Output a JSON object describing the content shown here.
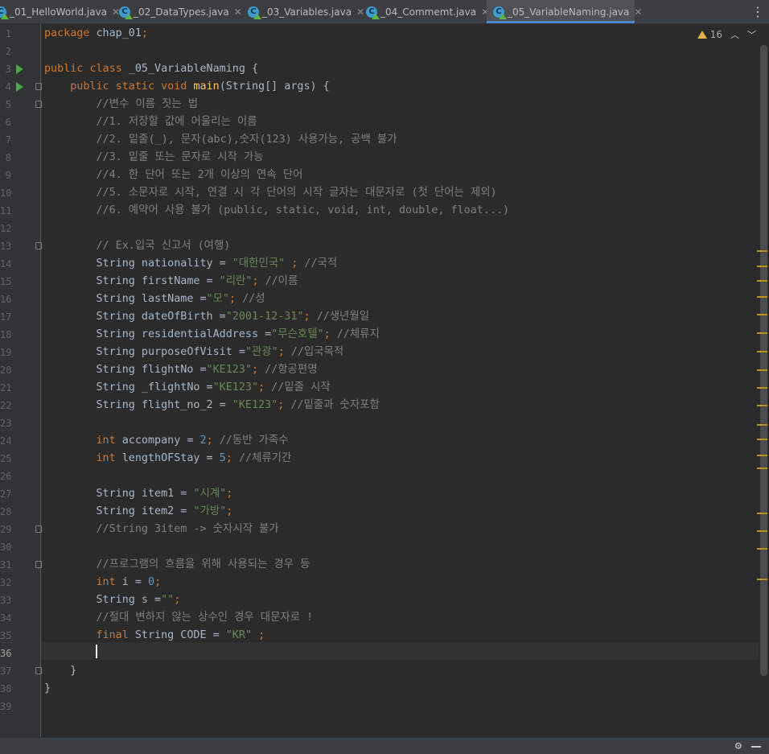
{
  "tabs": [
    {
      "label": "_01_HelloWorld.java",
      "icon": "java-class-icon"
    },
    {
      "label": "_02_DataTypes.java",
      "icon": "java-class-icon"
    },
    {
      "label": "_03_Variables.java",
      "icon": "java-class-icon"
    },
    {
      "label": "_04_Commemt.java",
      "icon": "java-class-icon"
    },
    {
      "label": "_05_VariableNaming.java",
      "icon": "java-class-icon",
      "active": true
    }
  ],
  "inspection": {
    "warning_count": "16"
  },
  "editor": {
    "current_line": 36,
    "lines": [
      {
        "n": "1",
        "t": "package chap_01;"
      },
      {
        "n": "2",
        "t": ""
      },
      {
        "n": "3",
        "t": "public class _05_VariableNaming {"
      },
      {
        "n": "4",
        "t": "    public static void main(String[] args) {"
      },
      {
        "n": "5",
        "t": "        //변수 이름 짓는 법"
      },
      {
        "n": "6",
        "t": "        //1. 저장할 값에 어울리는 이름"
      },
      {
        "n": "7",
        "t": "        //2. 밑줄(_), 문자(abc),숫자(123) 사용가능, 공백 불가"
      },
      {
        "n": "8",
        "t": "        //3. 밑줄 또는 문자로 시작 가능"
      },
      {
        "n": "9",
        "t": "        //4. 한 단어 또는 2개 이상의 연속 단어"
      },
      {
        "n": "10",
        "t": "        //5. 소문자로 시작, 연결 시 각 단어의 시작 글자는 대문자로 (첫 단어는 제외)"
      },
      {
        "n": "11",
        "t": "        //6. 예약어 사용 불가 (public, static, void, int, double, float...)"
      },
      {
        "n": "12",
        "t": ""
      },
      {
        "n": "13",
        "t": "        // Ex.입국 신고서 (여행)"
      },
      {
        "n": "14",
        "t": "        String nationality = \"대한민국\" ; //국적"
      },
      {
        "n": "15",
        "t": "        String firstName = \"리란\"; //이름"
      },
      {
        "n": "16",
        "t": "        String lastName =\"모\"; //성"
      },
      {
        "n": "17",
        "t": "        String dateOfBirth =\"2001-12-31\"; //생년월일"
      },
      {
        "n": "18",
        "t": "        String residentialAddress =\"무슨호텔\"; //체류지"
      },
      {
        "n": "19",
        "t": "        String purposeOfVisit =\"관광\"; //입국목적"
      },
      {
        "n": "20",
        "t": "        String flightNo =\"KE123\"; //항공편명"
      },
      {
        "n": "21",
        "t": "        String _flightNo =\"KE123\"; //밑줄 시작"
      },
      {
        "n": "22",
        "t": "        String flight_no_2 = \"KE123\"; //밑줄과 숫자포함"
      },
      {
        "n": "23",
        "t": ""
      },
      {
        "n": "24",
        "t": "        int accompany = 2; //동반 가족수"
      },
      {
        "n": "25",
        "t": "        int lengthOFStay = 5; //체류기간"
      },
      {
        "n": "26",
        "t": ""
      },
      {
        "n": "27",
        "t": "        String item1 = \"시계\";"
      },
      {
        "n": "28",
        "t": "        String item2 = \"가방\";"
      },
      {
        "n": "29",
        "t": "        //String 3item -> 숫자시작 불가"
      },
      {
        "n": "30",
        "t": ""
      },
      {
        "n": "31",
        "t": "        //프로그램의 흐름을 위해 사용되는 경우 등"
      },
      {
        "n": "32",
        "t": "        int i = 0;"
      },
      {
        "n": "33",
        "t": "        String s =\"\";"
      },
      {
        "n": "34",
        "t": "        //절대 변하지 않는 상수인 경우 대문자로 !"
      },
      {
        "n": "35",
        "t": "        final String CODE = \"KR\" ;"
      },
      {
        "n": "36",
        "t": ""
      },
      {
        "n": "37",
        "t": "    }"
      },
      {
        "n": "38",
        "t": "}"
      },
      {
        "n": "39",
        "t": ""
      }
    ]
  },
  "colors": {
    "keyword": "#cc7832",
    "comment": "#808080",
    "string": "#6a8759",
    "number": "#6897bb",
    "method": "#ffc66d",
    "text": "#a9b7c6",
    "background": "#2b2b2b"
  }
}
